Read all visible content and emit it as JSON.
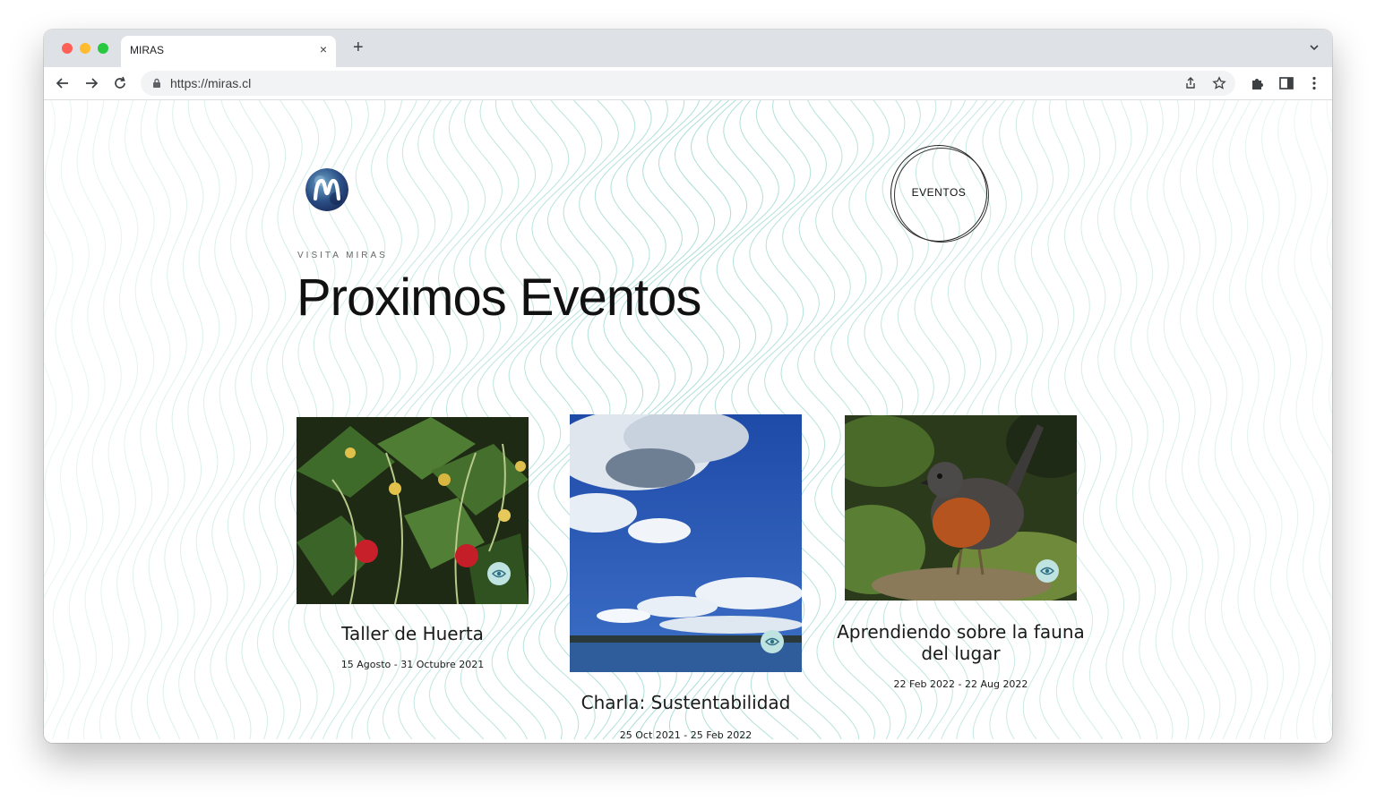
{
  "browser": {
    "tab_title": "MIRAS",
    "close_symbol": "×",
    "new_tab_symbol": "+",
    "url": "https://miras.cl"
  },
  "site": {
    "nav_button": "EVENTOS",
    "eyebrow": "VISITA MIRAS",
    "heading": "Proximos Eventos"
  },
  "events": [
    {
      "title": "Taller de Huerta",
      "date": "15 Agosto - 31 Octubre 2021"
    },
    {
      "title": "Charla: Sustentabilidad",
      "date": "25 Oct 2021 - 25 Feb 2022"
    },
    {
      "title": "Aprendiendo sobre la fauna del lugar",
      "date": "22 Feb 2022 - 22 Aug 2022"
    }
  ],
  "colors": {
    "wave_lines": "#8fd3c8",
    "eye_badge": "#bfe3e0",
    "tabbar": "#dee1e6"
  }
}
